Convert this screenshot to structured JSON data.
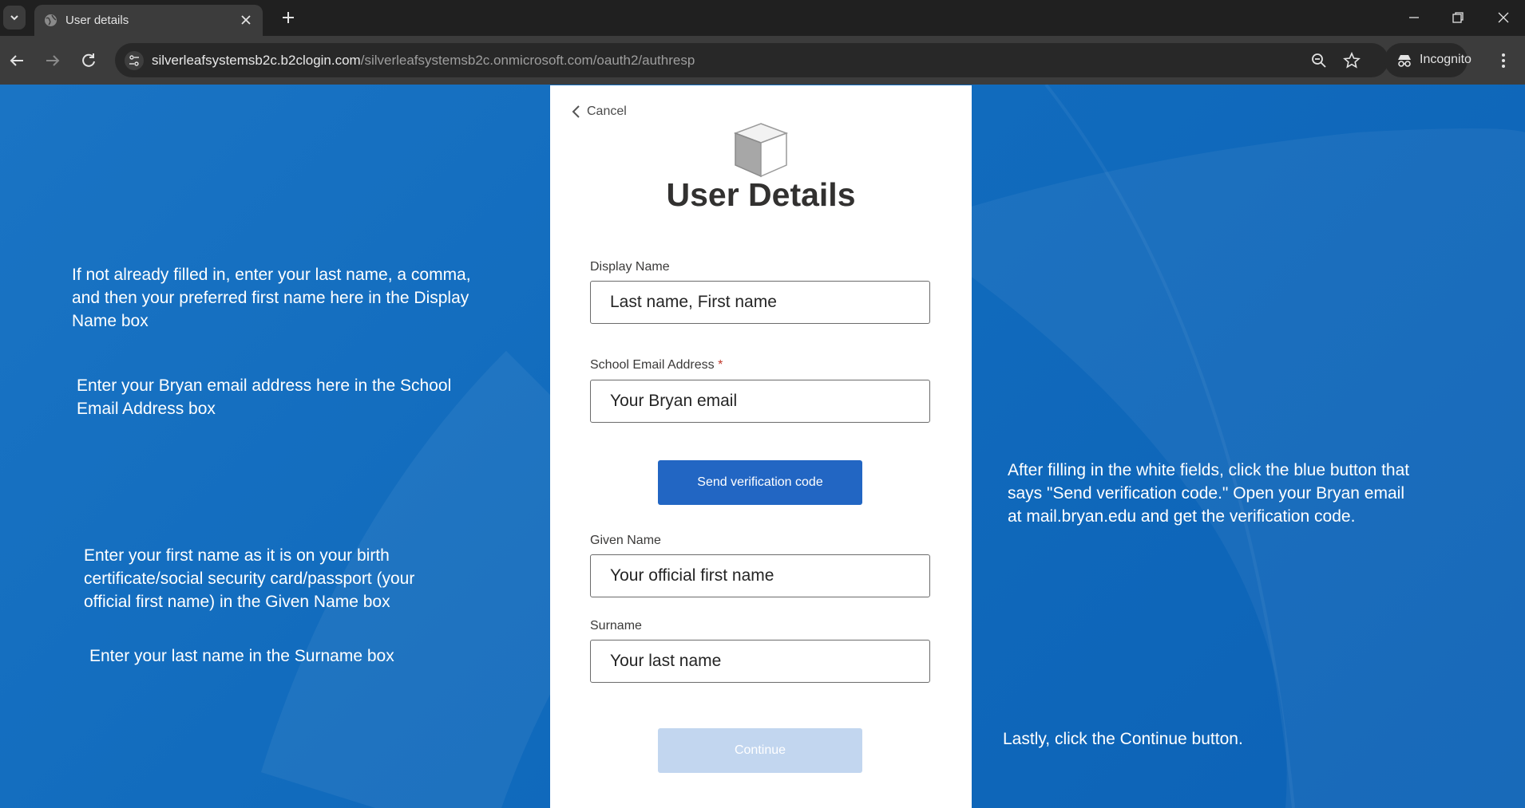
{
  "browser": {
    "tab_title": "User details",
    "url_host": "silverleafsystemsb2c.b2clogin.com",
    "url_path": "/silverleafsystemsb2c.onmicrosoft.com/oauth2/authresp",
    "incognito_label": "Incognito"
  },
  "card": {
    "cancel_label": "Cancel",
    "title": "User Details",
    "display_name_label": "Display Name",
    "display_name_value": "Last name, First name",
    "email_label": "School Email Address",
    "email_required_mark": "*",
    "email_value": "Your Bryan email",
    "send_code_label": "Send verification code",
    "given_name_label": "Given Name",
    "given_name_value": "Your official first name",
    "surname_label": "Surname",
    "surname_value": "Your last name",
    "continue_label": "Continue"
  },
  "instructions": {
    "display_name_l1": "If not already filled in, enter your last name, a comma,",
    "display_name_l2": "and then your preferred first name here in the Display",
    "display_name_l3": "Name box",
    "email_l1": "Enter your Bryan email address here in the School",
    "email_l2": "Email Address box",
    "given_l1": "Enter your first name as it is on your birth",
    "given_l2": "certificate/social security card/passport (your",
    "given_l3": "official first name) in the Given Name box",
    "surname_l1": "Enter your last name in the Surname box",
    "verify_l1": "After filling in the white fields, click the blue button that",
    "verify_l2": "says \"Send verification code.\"  Open your Bryan email",
    "verify_l3": "at mail.bryan.edu and get the verification code.",
    "continue_l1": "Lastly, click the Continue button."
  },
  "colors": {
    "page_background": "#116bbd",
    "send_button": "#2266c3",
    "continue_button_disabled": "#c2d6ef"
  }
}
